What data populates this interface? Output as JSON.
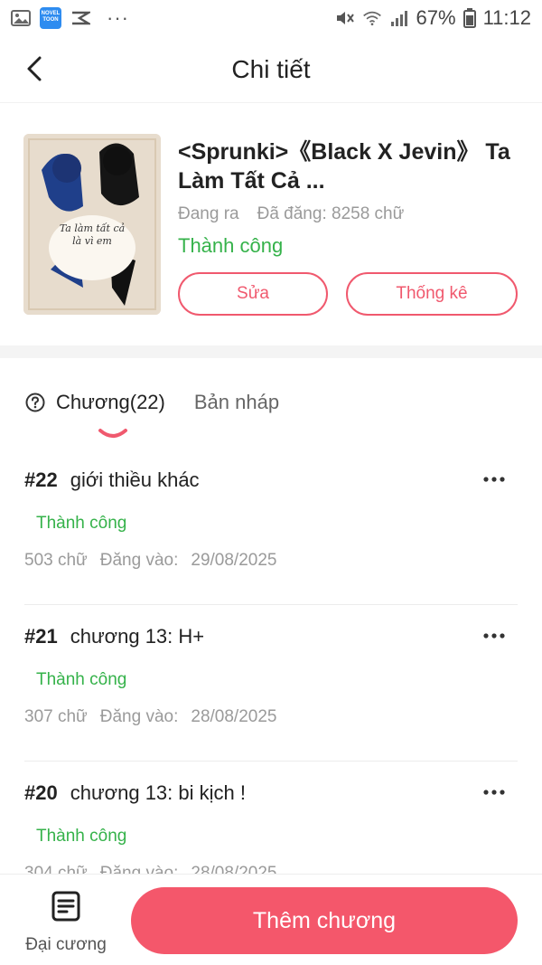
{
  "status_bar": {
    "battery_percent": "67%",
    "time": "11:12",
    "novel_app_line1": "NOVEL",
    "novel_app_line2": "TOON",
    "more_glyph": "···",
    "icons": [
      "gallery-icon",
      "noveltoon-app-icon",
      "capcut-icon",
      "more-dots-icon",
      "mute-icon",
      "wifi-icon",
      "signal-icon",
      "battery-icon"
    ]
  },
  "header": {
    "title": "Chi tiết",
    "back_icon": "chevron-left-icon"
  },
  "book": {
    "title": "<Sprunki>《Black X Jevin》 Ta Làm Tất Cả ...",
    "state": "Đang ra",
    "word_count": "Đã đăng: 8258 chữ",
    "status": "Thành công",
    "edit_label": "Sửa",
    "stats_label": "Thống kê",
    "cover_text": "Ta làm tất cả là vì em"
  },
  "tabs": {
    "chapters": "Chương(22)",
    "drafts": "Bản nháp"
  },
  "chapters": [
    {
      "num": "#22",
      "title": "giới thiều khác",
      "status": "Thành công",
      "words": "503 chữ",
      "published_label": "Đăng vào:",
      "date": "29/08/2025"
    },
    {
      "num": "#21",
      "title": "chương 13: H+",
      "status": "Thành công",
      "words": "307 chữ",
      "published_label": "Đăng vào:",
      "date": "28/08/2025"
    },
    {
      "num": "#20",
      "title": "chương 13: bi kịch !",
      "status": "Thành công",
      "words": "304 chữ",
      "published_label": "Đăng vào:",
      "date": "28/08/2025"
    }
  ],
  "bottom": {
    "outline_label": "Đại cương",
    "add_chapter_label": "Thêm chương"
  },
  "colors": {
    "accent": "#f4576b",
    "success": "#35b24a",
    "muted": "#9a9a9a"
  }
}
